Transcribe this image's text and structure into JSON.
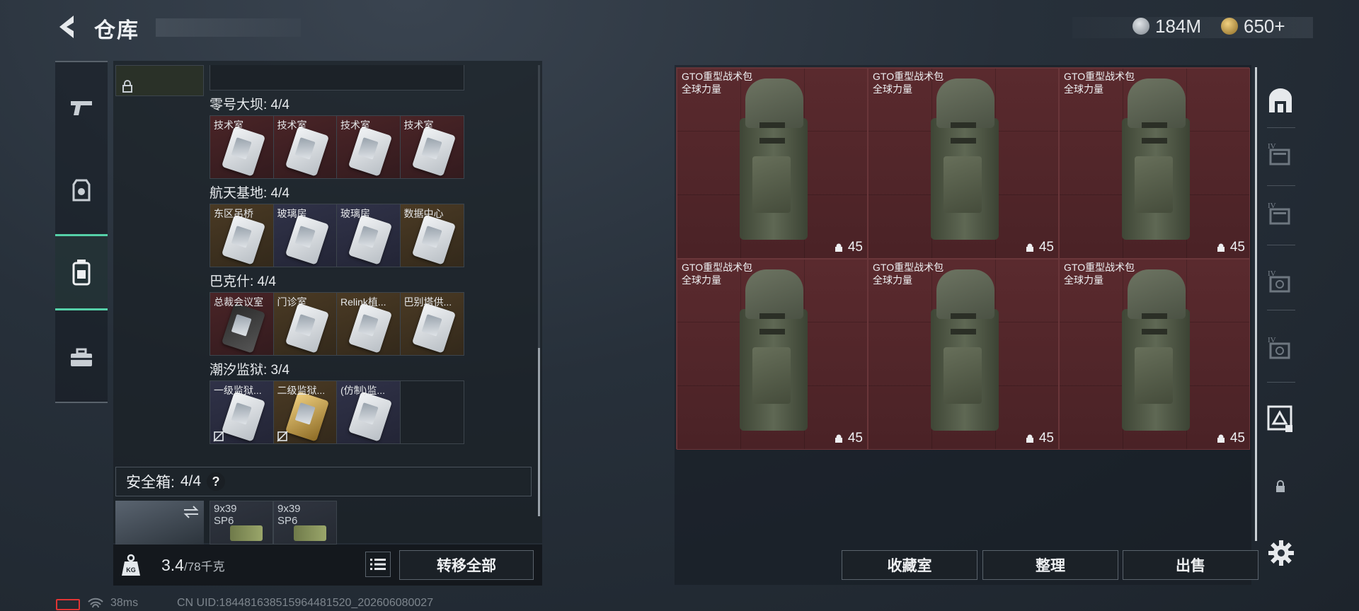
{
  "header": {
    "title": "仓库",
    "currency1": "184M",
    "currency2": "650+"
  },
  "left": {
    "sections": [
      {
        "title": "零号大坝: 4/4",
        "cards": [
          {
            "label": "技术室",
            "rarity": "red"
          },
          {
            "label": "技术室",
            "rarity": "red"
          },
          {
            "label": "技术室",
            "rarity": "red"
          },
          {
            "label": "技术室",
            "rarity": "red"
          }
        ]
      },
      {
        "title": "航天基地: 4/4",
        "cards": [
          {
            "label": "东区吊桥",
            "rarity": "gold"
          },
          {
            "label": "玻璃房",
            "rarity": "purple"
          },
          {
            "label": "玻璃房",
            "rarity": "purple"
          },
          {
            "label": "数据中心",
            "rarity": "gold"
          }
        ]
      },
      {
        "title": "巴克什: 4/4",
        "cards": [
          {
            "label": "总裁会议室",
            "rarity": "red"
          },
          {
            "label": "门诊室",
            "rarity": "gold"
          },
          {
            "label": "Relink植...",
            "rarity": "gold"
          },
          {
            "label": "巴别塔供...",
            "rarity": "gold"
          }
        ]
      },
      {
        "title": "潮汐监狱: 3/4",
        "cards": [
          {
            "label": "一级监狱...",
            "rarity": "purple"
          },
          {
            "label": "二级监狱...",
            "rarity": "gold"
          },
          {
            "label": "(仿制)监...",
            "rarity": "purple"
          },
          {
            "label": "",
            "rarity": "empty"
          }
        ]
      }
    ],
    "safe": {
      "label": "安全箱:",
      "count": "4/4",
      "help": "?",
      "ammo": [
        {
          "line1": "9x39",
          "line2": "SP6"
        },
        {
          "line1": "9x39",
          "line2": "SP6"
        }
      ]
    },
    "weight_value": "3.4",
    "weight_max": "/78千克",
    "transfer_label": "转移全部"
  },
  "grid": {
    "items": [
      {
        "name": "GTO重型战术包",
        "sub": "全球力量",
        "count": "45"
      },
      {
        "name": "GTO重型战术包",
        "sub": "全球力量",
        "count": "45"
      },
      {
        "name": "GTO重型战术包",
        "sub": "全球力量",
        "count": "45"
      },
      {
        "name": "GTO重型战术包",
        "sub": "全球力量",
        "count": "45"
      },
      {
        "name": "GTO重型战术包",
        "sub": "全球力量",
        "count": "45"
      },
      {
        "name": "GTO重型战术包",
        "sub": "全球力量",
        "count": "45"
      }
    ]
  },
  "buttons": {
    "collection": "收藏室",
    "organize": "整理",
    "sell": "出售"
  },
  "status": {
    "ping": "38ms",
    "uid": "CN UID:18448163851596448152​0_202606080027"
  },
  "colors": {
    "accent": "#55d0a8",
    "item_red": "#4a2226",
    "battery": "#e03535"
  }
}
